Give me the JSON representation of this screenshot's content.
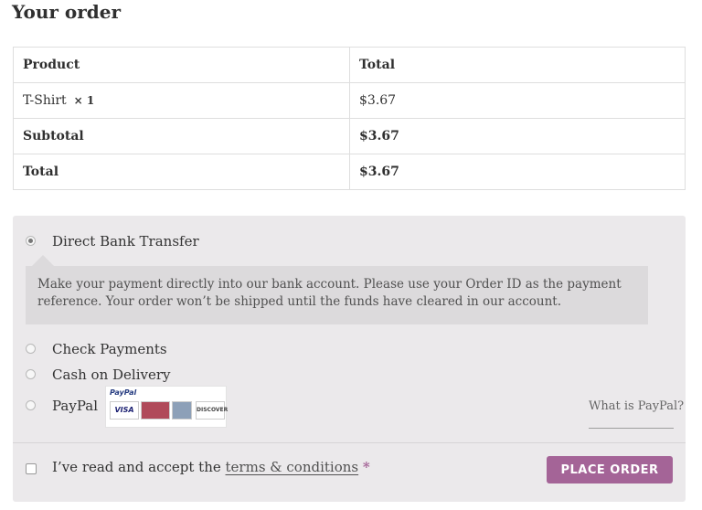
{
  "heading": "Your order",
  "table": {
    "headers": [
      "Product",
      "Total"
    ],
    "item": {
      "name": "T-Shirt",
      "qty": "× 1",
      "total": "$3.67"
    },
    "subtotal": {
      "label": "Subtotal",
      "value": "$3.67"
    },
    "total": {
      "label": "Total",
      "value": "$3.67"
    }
  },
  "payment": {
    "methods": [
      {
        "label": "Direct Bank Transfer",
        "selected": true
      },
      {
        "label": "Check Payments",
        "selected": false
      },
      {
        "label": "Cash on Delivery",
        "selected": false
      },
      {
        "label": "PayPal",
        "selected": false
      }
    ],
    "bank_description": "Make your payment directly into our bank account. Please use your Order ID as the payment reference. Your order won’t be shipped until the funds have cleared in our account.",
    "paypal_logo_text": "PayPal",
    "card_logos": [
      "VISA",
      "MasterCard",
      "AMEX",
      "DISCOVER"
    ],
    "what_is_paypal": "What is PayPal?"
  },
  "terms": {
    "prefix": "I’ve read and accept the",
    "link": "terms & conditions",
    "required_mark": "*"
  },
  "place_order_label": "PLACE ORDER",
  "colors": {
    "accent": "#a46497",
    "panel": "#ebe9eb",
    "description_bg": "#dcdadc"
  }
}
